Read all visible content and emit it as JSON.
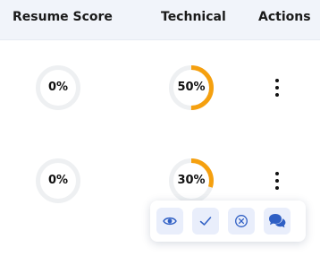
{
  "table": {
    "columns": [
      "Resume Score",
      "Technical",
      "Actions"
    ],
    "rows": [
      {
        "resume_score": "0%",
        "resume_value": 0,
        "technical": "50%",
        "technical_value": 50
      },
      {
        "resume_score": "0%",
        "resume_value": 0,
        "technical": "30%",
        "technical_value": 30
      }
    ]
  },
  "actions_menu": {
    "items": [
      {
        "icon": "eye-icon"
      },
      {
        "icon": "check-icon"
      },
      {
        "icon": "close-circle-icon"
      },
      {
        "icon": "chat-bubbles-icon"
      }
    ]
  },
  "colors": {
    "progress": "#f5a00f",
    "track": "#eef0f2",
    "icon": "#2f5fc4",
    "header_bg": "#f1f4fa"
  }
}
